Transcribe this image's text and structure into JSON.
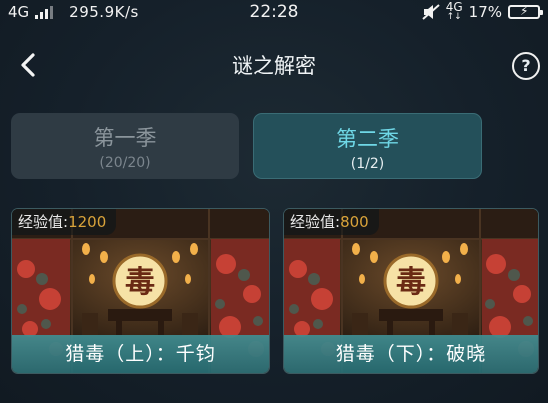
{
  "status_bar": {
    "network_left": "4G",
    "net_speed": "295.9K/s",
    "time": "22:28",
    "network_right": "4G",
    "battery": "17%",
    "icons": [
      "signal-icon",
      "mute-icon",
      "battery-charging-icon"
    ]
  },
  "nav": {
    "title": "谜之解密",
    "back_icon": "chevron-left-icon",
    "help_label": "?"
  },
  "seasons": [
    {
      "name": "第一季",
      "progress": "(20/20)",
      "selected": false
    },
    {
      "name": "第二季",
      "progress": "(1/2)",
      "selected": true
    }
  ],
  "cards": [
    {
      "exp_label": "经验值:",
      "exp_value": "1200",
      "title": "猎毒（上）：千钧",
      "emblem": "毒"
    },
    {
      "exp_label": "经验值:",
      "exp_value": "800",
      "title": "猎毒（下）：破晓",
      "emblem": "毒"
    }
  ],
  "colors": {
    "background": "#16212a",
    "active_tab": "#24505a",
    "active_tab_text": "#6fd7e6",
    "inactive_tab": "#2f3b44",
    "card_title_bar": "#3a8a8f",
    "exp_value": "#d9a33a"
  }
}
